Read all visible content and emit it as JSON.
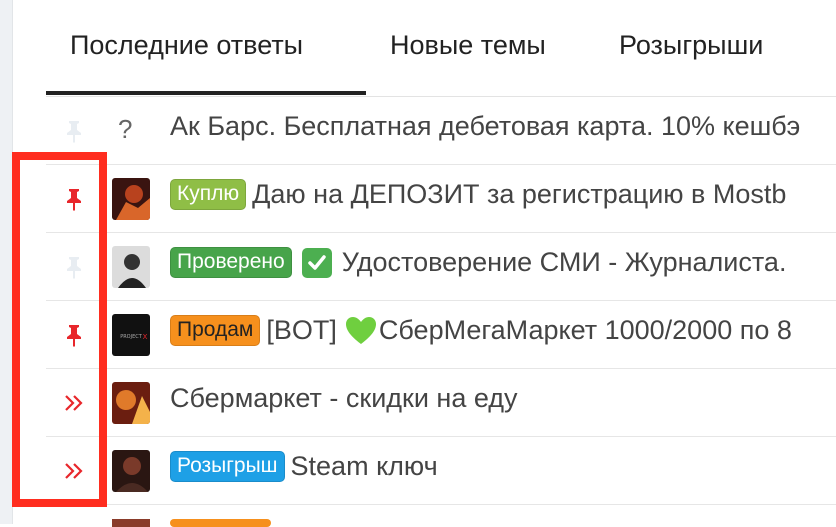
{
  "tabs": [
    {
      "label": "Последние ответы",
      "active": true
    },
    {
      "label": "Новые темы",
      "active": false
    },
    {
      "label": "Розыгрыши",
      "active": false
    }
  ],
  "rows": [
    {
      "marker_icon": "pin-icon-faded",
      "prefix": "?",
      "badge": "",
      "title": "Ак Барс. Бесплатная дебетовая карта. 10% кешбэ"
    },
    {
      "marker_icon": "pin-icon-red",
      "avatar_color": "#7a2a1a",
      "badge": "Куплю",
      "badge_color": "#8fbe46",
      "title": "Даю на ДЕПОЗИТ за регистрацию в Mostb"
    },
    {
      "marker_icon": "pin-icon-faded",
      "avatar_color": "#555555",
      "badge": "Проверено",
      "badge_color": "#47a44a",
      "emoji": "check-mark-icon",
      "title": "Удостоверение СМИ - Журналиста."
    },
    {
      "marker_icon": "pin-icon-red",
      "avatar_color": "#111111",
      "avatar_text": "PROJECT X",
      "badge": "Продам",
      "badge_color": "#f6901d",
      "title_prefix": "[BOT]",
      "emoji": "green-heart-icon",
      "title": "СберМегаМаркет 1000/2000 по 8"
    },
    {
      "marker_icon": "double-chevron-right-icon",
      "avatar_color": "#b8421e",
      "badge": "",
      "title": "Сбермаркет - скидки на еду"
    },
    {
      "marker_icon": "double-chevron-right-icon",
      "avatar_color": "#4a2a22",
      "badge": "Розыгрыш",
      "badge_color": "#1ea0e6",
      "title": "Steam ключ"
    }
  ],
  "colors": {
    "highlight": "#ff2d1f",
    "pin_red": "#e8262b",
    "pin_faded": "#e8edf2"
  }
}
